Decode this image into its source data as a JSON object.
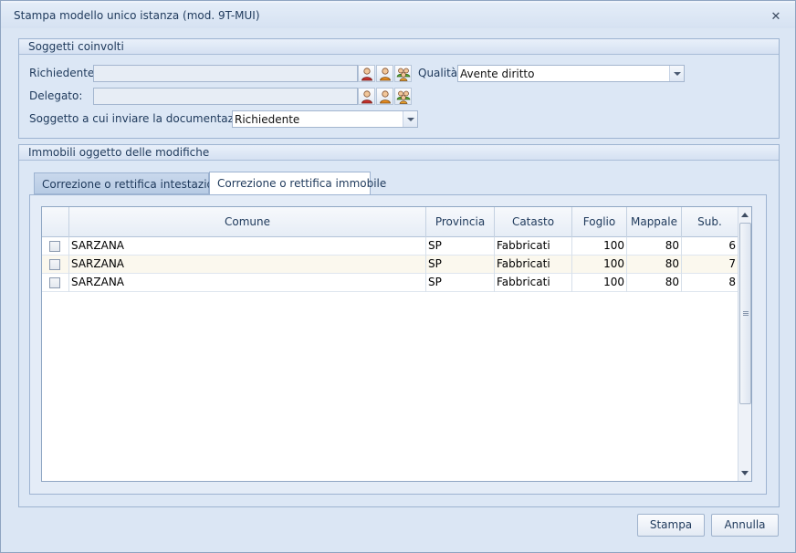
{
  "window": {
    "title": "Stampa modello unico istanza (mod. 9T-MUI)"
  },
  "soggetti": {
    "group_title": "Soggetti coinvolti",
    "richiedente_label": "Richiedente:",
    "richiedente_value": "",
    "delegato_label": "Delegato:",
    "delegato_value": "",
    "qualita_label": "Qualità",
    "qualita_value": "Avente diritto",
    "invio_label": "Soggetto a cui inviare la documentazione:",
    "invio_value": "Richiedente",
    "person_icons": [
      "person-red-icon",
      "person-orange-icon",
      "people-group-icon"
    ]
  },
  "immobili": {
    "group_title": "Immobili oggetto delle modifiche",
    "tabs": [
      {
        "label": "Correzione o rettifica intestazione",
        "active": false
      },
      {
        "label": "Correzione o rettifica immobile",
        "active": true
      }
    ],
    "columns": [
      "",
      "Comune",
      "Provincia",
      "Catasto",
      "Foglio",
      "Mappale",
      "Sub."
    ],
    "rows": [
      {
        "checked": false,
        "comune": "SARZANA",
        "provincia": "SP",
        "catasto": "Fabbricati",
        "foglio": "100",
        "mappale": "80",
        "sub": "6"
      },
      {
        "checked": false,
        "comune": "SARZANA",
        "provincia": "SP",
        "catasto": "Fabbricati",
        "foglio": "100",
        "mappale": "80",
        "sub": "7"
      },
      {
        "checked": false,
        "comune": "SARZANA",
        "provincia": "SP",
        "catasto": "Fabbricati",
        "foglio": "100",
        "mappale": "80",
        "sub": "8"
      }
    ]
  },
  "buttons": {
    "stampa": "Stampa",
    "annulla": "Annulla"
  },
  "colors": {
    "accent": "#1e395b",
    "window_bg": "#dbe6f4",
    "row_alt": "#fbf8ee"
  }
}
